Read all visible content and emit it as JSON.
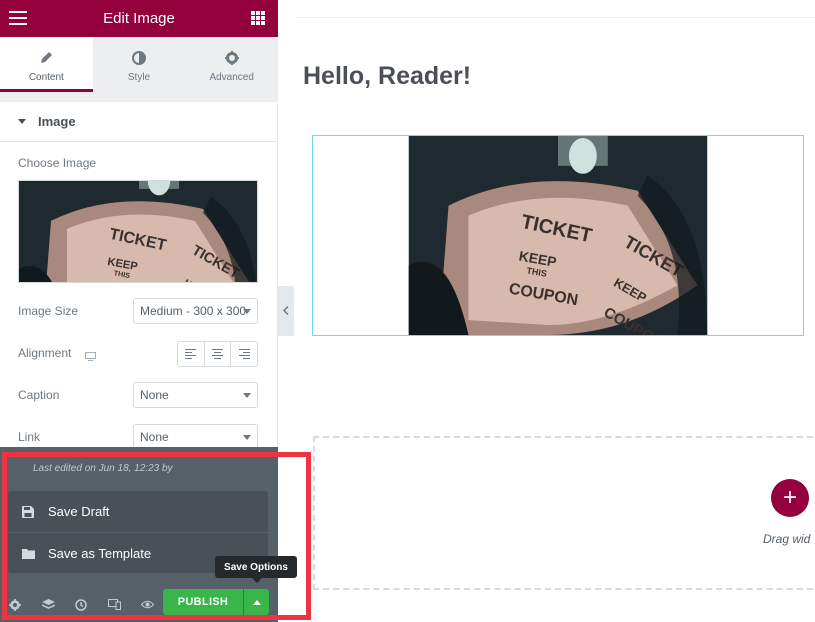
{
  "header": {
    "title": "Edit Image"
  },
  "tabs": [
    {
      "label": "Content",
      "icon": "pencil-icon",
      "active": true
    },
    {
      "label": "Style",
      "icon": "half-circle-icon",
      "active": false
    },
    {
      "label": "Advanced",
      "icon": "gear-icon",
      "active": false
    }
  ],
  "section": {
    "title": "Image"
  },
  "controls": {
    "choose_image_label": "Choose Image",
    "image_size": {
      "label": "Image Size",
      "value": "Medium - 300 x 300"
    },
    "alignment": {
      "label": "Alignment",
      "options": [
        "left",
        "center",
        "right"
      ]
    },
    "caption": {
      "label": "Caption",
      "value": "None"
    },
    "link": {
      "label": "Link",
      "value": "None"
    }
  },
  "footer": {
    "last_edited": "Last edited on Jun 18, 12:23 by",
    "save_menu": [
      {
        "label": "Save Draft",
        "icon": "floppy-disk-icon"
      },
      {
        "label": "Save as Template",
        "icon": "folder-icon"
      }
    ],
    "publish_label": "PUBLISH",
    "save_options_tooltip": "Save Options"
  },
  "preview": {
    "heading": "Hello, Reader!",
    "drag_text": "Drag wid"
  },
  "image_text": {
    "ticket": "TICKET",
    "keep": "KEEP",
    "this": "THIS",
    "coupon": "COUPON"
  },
  "colors": {
    "brand": "#93003c",
    "publish": "#39b54a",
    "highlight": "#ef3340",
    "selection": "#71d7f7"
  }
}
